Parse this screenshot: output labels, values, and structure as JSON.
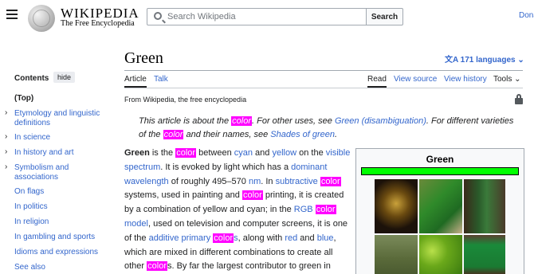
{
  "header": {
    "wordmark": "WIKIPEDIA",
    "tagline": "The Free Encyclopedia",
    "search_placeholder": "Search Wikipedia",
    "search_button": "Search",
    "donate": "Donate"
  },
  "toc": {
    "title": "Contents",
    "hide_label": "hide",
    "items": [
      {
        "label": "(Top)"
      },
      {
        "label": "Etymology and linguistic definitions"
      },
      {
        "label": "In science"
      },
      {
        "label": "In history and art"
      },
      {
        "label": "Symbolism and associations"
      },
      {
        "label": "On flags"
      },
      {
        "label": "In politics"
      },
      {
        "label": "In religion"
      },
      {
        "label": "In gambling and sports"
      },
      {
        "label": "Idioms and expressions"
      },
      {
        "label": "See also"
      }
    ]
  },
  "article": {
    "title": "Green",
    "languages": "171 languages",
    "tabs": {
      "article": "Article",
      "talk": "Talk",
      "read": "Read",
      "view_source": "View source",
      "view_history": "View history",
      "tools": "Tools"
    },
    "from": "From Wikipedia, the free encyclopedia",
    "hatnote": {
      "p1": "This article is about the ",
      "hl1": "color",
      "p2": ". For other uses, see ",
      "link1": "Green (disambiguation)",
      "p3": ". For different varieties of the ",
      "hl2": "color",
      "p4": " and their names, see ",
      "link2": "Shades of green",
      "p5": "."
    },
    "body": {
      "bold": "Green",
      "t1": " is the ",
      "hl1": "color",
      "t2": " between ",
      "l_cyan": "cyan",
      "t3": " and ",
      "l_yellow": "yellow",
      "t4": " on the ",
      "l_visible": "visible spectrum",
      "t5": ". It is evoked by light which has a ",
      "l_dominant": "dominant wavelength",
      "t6": " of roughly 495–570 ",
      "l_nm": "nm",
      "t7": ". In ",
      "l_subtractive": "subtractive",
      "hl2": "color",
      "t8": " systems, used in painting and ",
      "hl3": "color",
      "t9": " printing, it is created by a combination of yellow and cyan; in the ",
      "l_rgb": "RGB",
      "hl4": "color",
      "l_model": "model",
      "t10": ", used on television and computer screens, it is one of the ",
      "l_additive": "additive primary",
      "hl5": "color",
      "l_s": "s",
      "t11": ", along with ",
      "l_red": "red",
      "t12": " and ",
      "l_blue": "blue",
      "t13": ", which are mixed in different combinations to create all other ",
      "hl6": "color",
      "t14": "s. By far the largest contributor to green in"
    },
    "infobox": {
      "title": "Green",
      "swatch_color": "#00ff00"
    }
  }
}
